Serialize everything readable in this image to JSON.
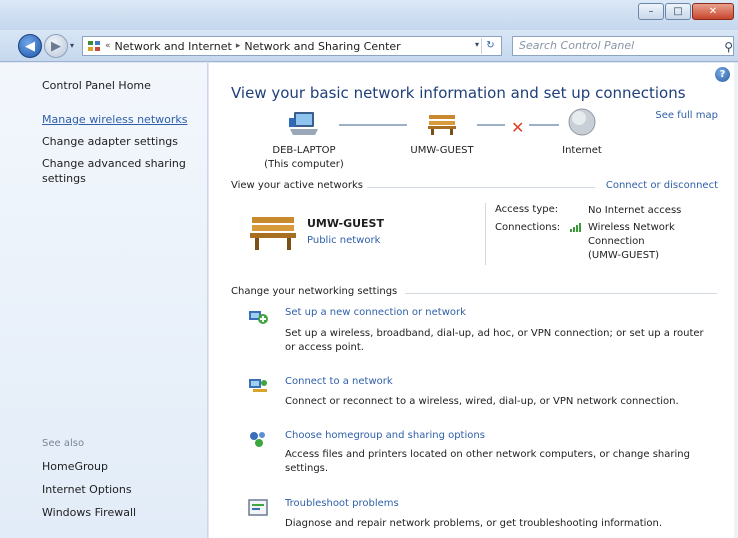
{
  "window": {
    "minimize": "–",
    "maximize": "□",
    "close": "✕"
  },
  "navbar": {
    "back": "◀",
    "forward": "▶",
    "history": "▾",
    "breadcrumb_sep1": "«",
    "breadcrumb": [
      "Network and Internet",
      "Network and Sharing Center"
    ],
    "breadcrumb_sep2": "▸",
    "dropdown": "▾",
    "refresh": "↻",
    "search_placeholder": "Search Control Panel",
    "search_glyph": "⚲"
  },
  "sidebar": {
    "home": "Control Panel Home",
    "links": [
      "Manage wireless networks",
      "Change adapter settings",
      "Change advanced sharing",
      "settings"
    ],
    "see_also_heading": "See also",
    "see_also": [
      "HomeGroup",
      "Internet Options",
      "Windows Firewall"
    ]
  },
  "main": {
    "help": "?",
    "title": "View your basic network information and set up connections",
    "see_full_map": "See full map",
    "map": {
      "computer_name": "DEB-LAPTOP",
      "computer_sub": "(This computer)",
      "network_name": "UMW-GUEST",
      "internet": "Internet",
      "broken_link": "✕"
    },
    "active_networks": {
      "heading": "View your active networks",
      "action": "Connect or disconnect",
      "name": "UMW-GUEST",
      "type": "Public network",
      "access_type_label": "Access type:",
      "access_type_value": "No Internet access",
      "connections_label": "Connections:",
      "connections_value": [
        "Wireless Network",
        "Connection",
        "(UMW-GUEST)"
      ]
    },
    "settings": {
      "heading": "Change your networking settings",
      "tasks": [
        {
          "title": "Set up a new connection or network",
          "desc": [
            "Set up a wireless, broadband, dial-up, ad hoc, or VPN connection; or set up a router",
            "or access point."
          ]
        },
        {
          "title": "Connect to a network",
          "desc": [
            "Connect or reconnect to a wireless, wired, dial-up, or VPN network connection."
          ]
        },
        {
          "title": "Choose homegroup and sharing options",
          "desc": [
            "Access files and printers located on other network computers, or change sharing",
            "settings."
          ]
        },
        {
          "title": "Troubleshoot problems",
          "desc": [
            "Diagnose and repair network problems, or get troubleshooting information."
          ]
        }
      ]
    }
  },
  "colors": {
    "link": "#2f5fa8",
    "title": "#1f3f7a",
    "error": "#d8452a"
  }
}
